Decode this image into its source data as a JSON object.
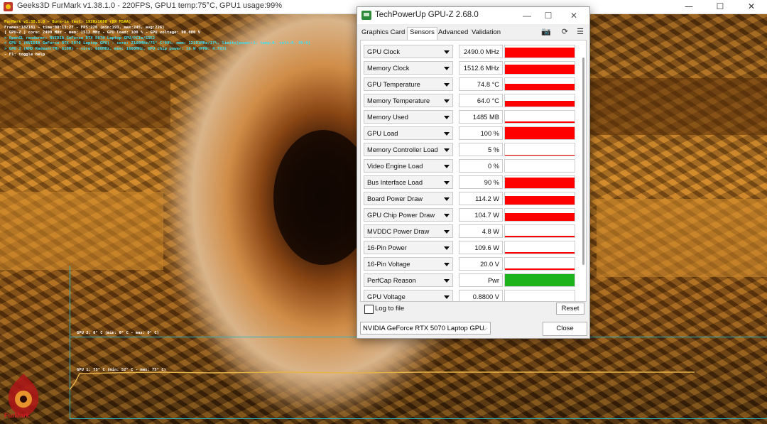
{
  "furmark": {
    "title": "Geeks3D FurMark v1.38.1.0 - 220FPS, GPU1 temp:75°C, GPU1 usage:99%",
    "controls": {
      "minimize": "—",
      "maximize": "☐",
      "close": "✕"
    },
    "overlay": {
      "line1": "FurMark v1.38.1.0 - Burn-in test, 1920x1080 (0X MSAA)",
      "line2": "Frames:182181 - time:00:13:27 - FPS:220 (min:193, max:245, avg:226)",
      "line3": "[ GPU-Z ] core: 2490 MHz - mem: 1512 MHz - GPU load: 100 % - GPU voltage: 90.000 V",
      "line4": "> OpenGL renderer: NVIDIA GeForce RTX 5070 Laptop GPU/PCIe/SSE2",
      "line5": "> GPU 1 (NVIDIA GeForce RTX 5070 Laptop GPU) - core: 2160MHz/75° C/99%, mem: 12101MHz/17%, limits[power:1, temp:0, volt:0, OV:0]",
      "line6": "> GPU 2 (AMD Radeon(TM) 610M) - core: 600MHz, mem: 1600MHz, GPU chip power: 16 W (PPW: 4.783)",
      "line7": "- F1: toggle help"
    },
    "graph": {
      "gpu2_label": "GPU 2: 0° C (min: 0° C - max: 0° C)",
      "gpu1_label": "GPU 1: 75° C (min: 52° C - max: 75° C)",
      "line_color": "#e8b24a",
      "frame_color": "#27b5c7"
    },
    "logo_text": "FurMark"
  },
  "gpuz": {
    "title": "TechPowerUp GPU-Z 2.68.0",
    "controls": {
      "minimize": "—",
      "maximize": "☐",
      "close": "✕"
    },
    "tabs": [
      "Graphics Card",
      "Sensors",
      "Advanced",
      "Validation"
    ],
    "active_tab": "Sensors",
    "tool_icons": [
      "camera-icon",
      "refresh-icon",
      "menu-icon"
    ],
    "sensors": [
      {
        "name": "GPU Clock",
        "value": "2490.0 MHz",
        "level": 0.85,
        "color": "#ff0000"
      },
      {
        "name": "Memory Clock",
        "value": "1512.6 MHz",
        "level": 0.75,
        "color": "#ff0000"
      },
      {
        "name": "GPU Temperature",
        "value": "74.8 °C",
        "level": 0.55,
        "color": "#ff0000"
      },
      {
        "name": "Memory Temperature",
        "value": "64.0 °C",
        "level": 0.45,
        "color": "#ff0000"
      },
      {
        "name": "Memory Used",
        "value": "1485 MB",
        "level": 0.1,
        "color": "#ff0000"
      },
      {
        "name": "GPU Load",
        "value": "100 %",
        "level": 1.0,
        "color": "#ff0000"
      },
      {
        "name": "Memory Controller Load",
        "value": "5 %",
        "level": 0.05,
        "color": "#ff0000"
      },
      {
        "name": "Video Engine Load",
        "value": "0 %",
        "level": 0.0,
        "color": "#ff0000"
      },
      {
        "name": "Bus Interface Load",
        "value": "90 %",
        "level": 0.9,
        "color": "#ff0000"
      },
      {
        "name": "Board Power Draw",
        "value": "114.2 W",
        "level": 0.7,
        "color": "#ff0000"
      },
      {
        "name": "GPU Chip Power Draw",
        "value": "104.7 W",
        "level": 0.65,
        "color": "#ff0000"
      },
      {
        "name": "MVDDC Power Draw",
        "value": "4.8 W",
        "level": 0.12,
        "color": "#ff0000"
      },
      {
        "name": "16-Pin Power",
        "value": "109.6 W",
        "level": 0.1,
        "color": "#ff0000"
      },
      {
        "name": "16-Pin Voltage",
        "value": "20.0 V",
        "level": 0.1,
        "color": "#ff0000"
      },
      {
        "name": "PerfCap Reason",
        "value": "Pwr",
        "level": 1.0,
        "color": "#1db31d"
      },
      {
        "name": "GPU Voltage",
        "value": "0.8800 V",
        "level": 0.12,
        "color": "#ff0000"
      }
    ],
    "log_to_file": "Log to file",
    "reset": "Reset",
    "gpu_select": "NVIDIA GeForce RTX 5070 Laptop GPU",
    "close": "Close"
  }
}
